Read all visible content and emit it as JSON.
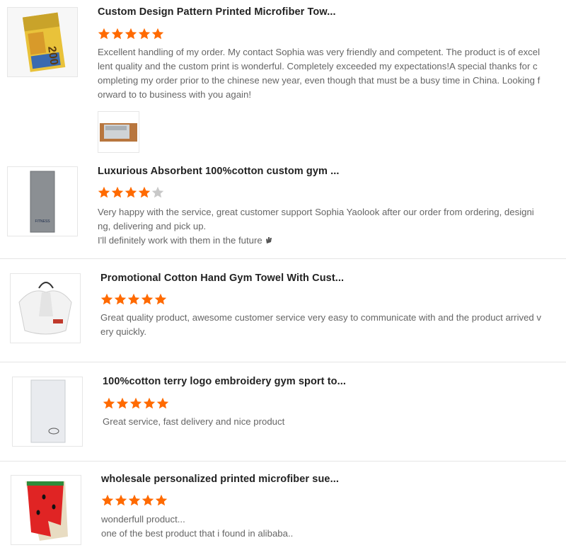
{
  "colors": {
    "star_filled": "#ff6a00",
    "star_empty": "#c8c8c8",
    "title": "#222222",
    "text": "#666666",
    "divider": "#e5e5e5"
  },
  "icons": {
    "star": "star-icon",
    "emoji": "waving-hand-icon"
  },
  "reviews": [
    {
      "product_title": "Custom Design Pattern Printed Microfiber Tow...",
      "rating": 5,
      "max_rating": 5,
      "text_lines": [
        "Excellent handling of my order. My contact Sophia was very friendly and competent. The product is of excel",
        "lent quality and the custom print is wonderful. Completely exceeded my expectations!A special thanks for c",
        "ompleting my order prior to the chinese new year, even though that must be a busy time in China. Looking f",
        "orward to to business with you again!"
      ],
      "has_photo": true
    },
    {
      "product_title": "Luxurious Absorbent 100%cotton custom gym ...",
      "rating": 4,
      "max_rating": 5,
      "text_lines": [
        "Very happy with the service, great customer support  Sophia Yaolook after our order  from ordering, designi",
        "ng, delivering and pick up.",
        "I'll definitely work with them in  the future"
      ],
      "thumb_label": "FITNESS"
    },
    {
      "product_title": "Promotional Cotton Hand Gym Towel With Cust...",
      "rating": 5,
      "max_rating": 5,
      "text_lines": [
        "Great quality product, awesome customer service very easy to communicate with and the product arrived v",
        "ery quickly."
      ]
    },
    {
      "product_title": "100%cotton terry logo embroidery gym sport to...",
      "rating": 5,
      "max_rating": 5,
      "text_lines": [
        "Great service, fast delivery and nice product"
      ]
    },
    {
      "product_title": "wholesale personalized printed microfiber sue...",
      "rating": 5,
      "max_rating": 5,
      "text_lines": [
        "wonderfull product...",
        "one of the best product that i found in alibaba.."
      ]
    }
  ]
}
